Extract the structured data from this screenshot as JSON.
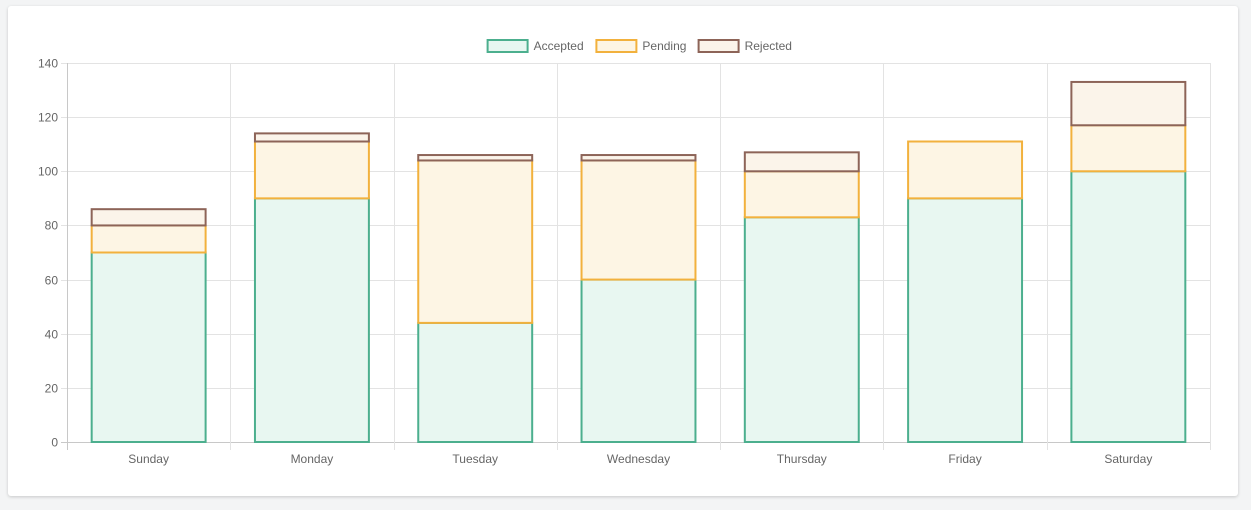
{
  "chart_data": {
    "type": "bar",
    "stacked": true,
    "categories": [
      "Sunday",
      "Monday",
      "Tuesday",
      "Wednesday",
      "Thursday",
      "Friday",
      "Saturday"
    ],
    "series": [
      {
        "name": "Accepted",
        "values": [
          70,
          90,
          44,
          60,
          83,
          90,
          100
        ],
        "border": "#4caf8e",
        "fill": "#e8f7f1"
      },
      {
        "name": "Pending",
        "values": [
          10,
          21,
          60,
          44,
          17,
          21,
          17
        ],
        "border": "#f2b13d",
        "fill": "#fdf5e4"
      },
      {
        "name": "Rejected",
        "values": [
          6,
          3,
          2,
          2,
          7,
          0,
          16
        ],
        "border": "#8d6458",
        "fill": "#fbf4ea"
      }
    ],
    "ylim": [
      0,
      140
    ],
    "yticks": [
      "0",
      "20",
      "40",
      "60",
      "80",
      "100",
      "120",
      "140"
    ],
    "grid": true,
    "legend_position": "top-center",
    "xlabel": "",
    "ylabel": ""
  }
}
